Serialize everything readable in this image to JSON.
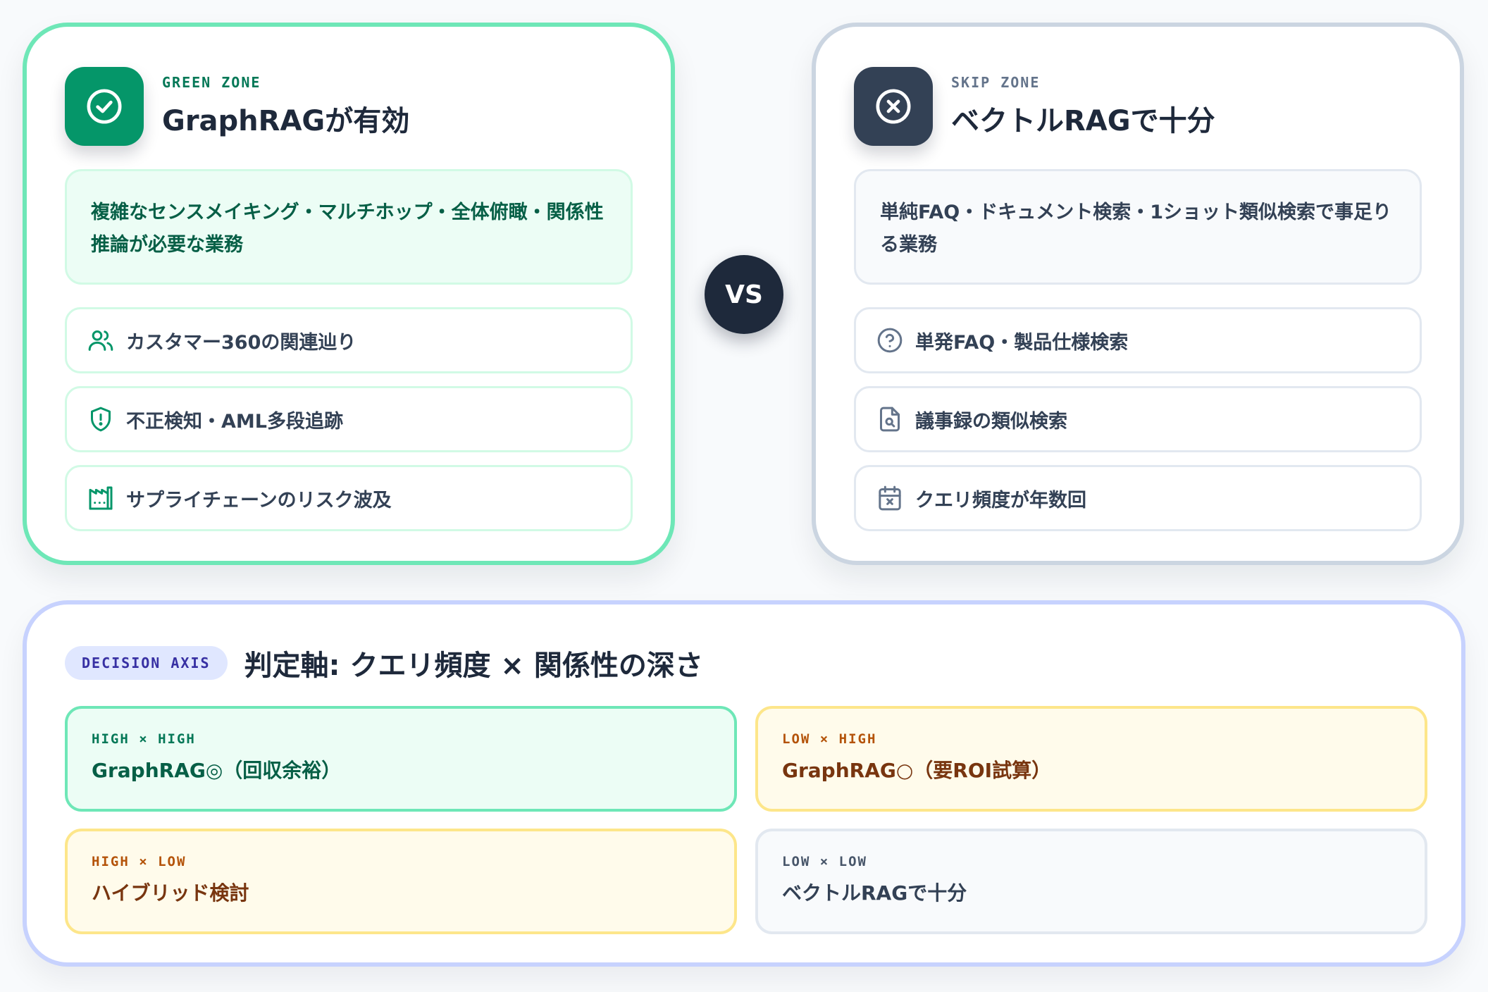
{
  "green_zone": {
    "tag": "GREEN ZONE",
    "title": "GraphRAGが有効",
    "icon": "check-circle-icon",
    "description": "複雑なセンスメイキング・マルチホップ・全体俯瞰・関係性推論が必要な業務",
    "items": [
      {
        "icon": "users-icon",
        "label": "カスタマー360の関連辿り"
      },
      {
        "icon": "shield-alert-icon",
        "label": "不正検知・AML多段追跡"
      },
      {
        "icon": "factory-icon",
        "label": "サプライチェーンのリスク波及"
      }
    ]
  },
  "vs_label": "VS",
  "skip_zone": {
    "tag": "SKIP ZONE",
    "title": "ベクトルRAGで十分",
    "icon": "x-circle-icon",
    "description": "単純FAQ・ドキュメント検索・1ショット類似検索で事足りる業務",
    "items": [
      {
        "icon": "help-circle-icon",
        "label": "単発FAQ・製品仕様検索"
      },
      {
        "icon": "file-search-icon",
        "label": "議事録の類似検索"
      },
      {
        "icon": "calendar-x-icon",
        "label": "クエリ頻度が年数回"
      }
    ]
  },
  "decision_axis": {
    "tag": "DECISION AXIS",
    "title": "判定軸: クエリ頻度 × 関係性の深さ",
    "cells": [
      {
        "tag": "HIGH × HIGH",
        "value": "GraphRAG◎（回収余裕）"
      },
      {
        "tag": "LOW × HIGH",
        "value": "GraphRAG○（要ROI試算）"
      },
      {
        "tag": "HIGH × LOW",
        "value": "ハイブリッド検討"
      },
      {
        "tag": "LOW × LOW",
        "value": "ベクトルRAGで十分"
      }
    ]
  },
  "colors": {
    "green_accent": "#059669",
    "skip_accent": "#334155",
    "axis_accent": "#3730a3",
    "amber_accent": "#b45309"
  }
}
